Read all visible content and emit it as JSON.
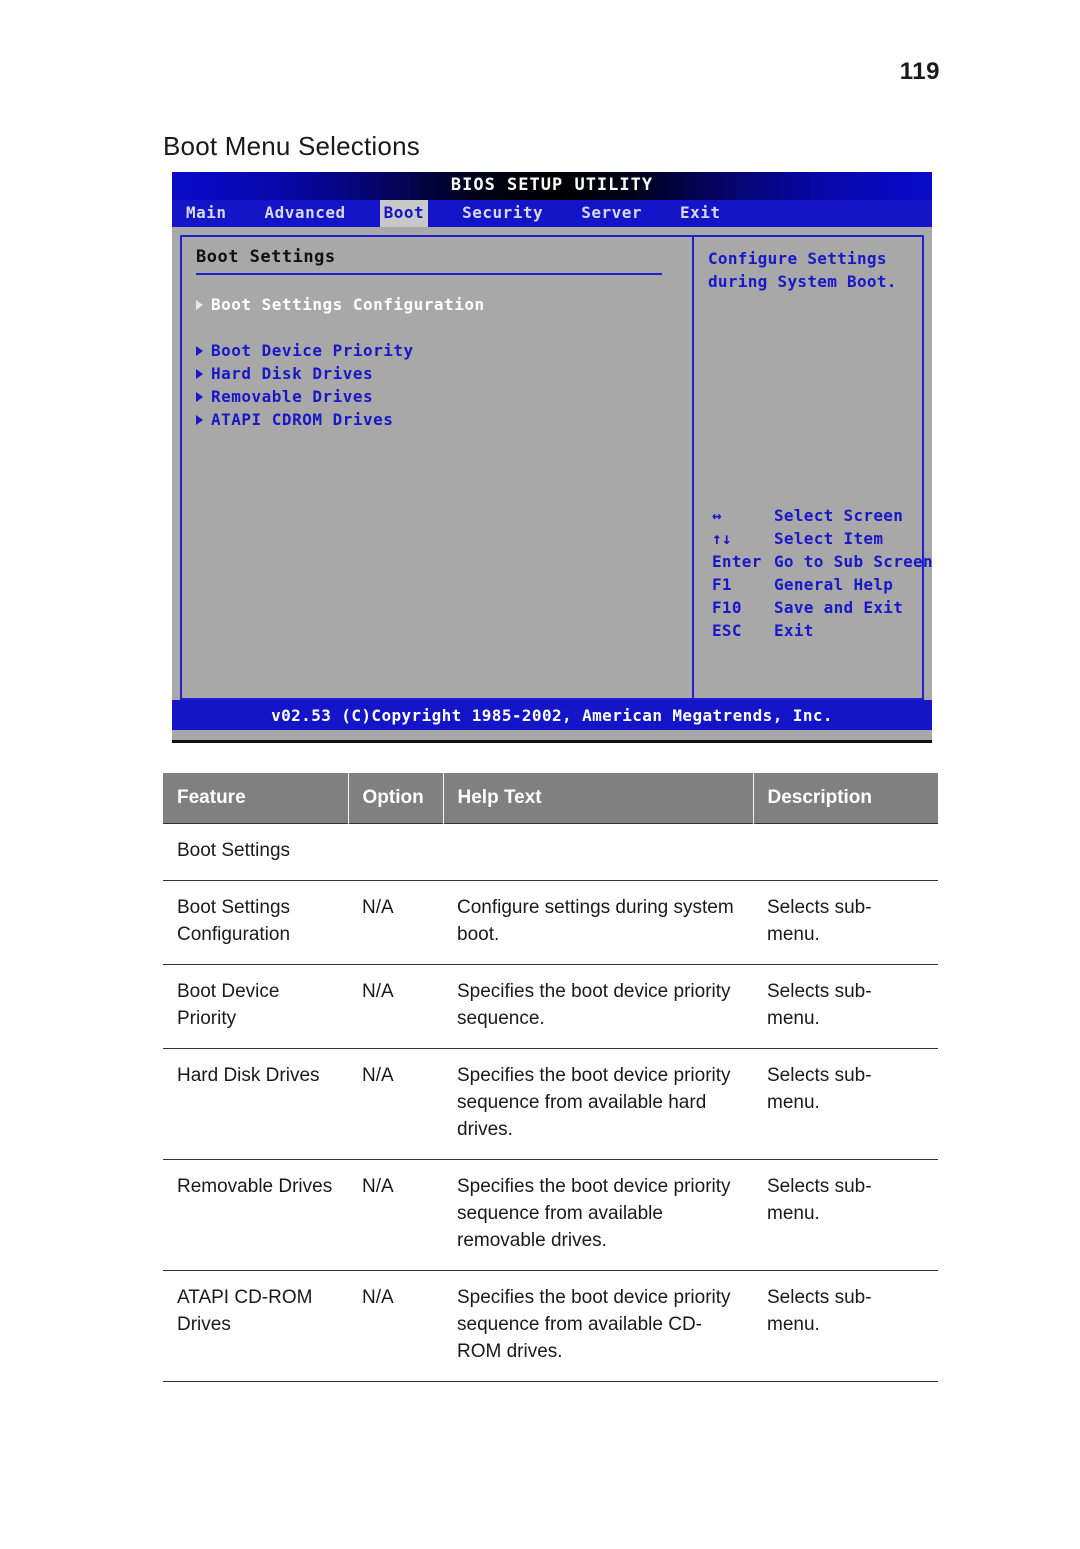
{
  "page": {
    "number": "119",
    "title": "Boot Menu Selections"
  },
  "bios": {
    "title": "BIOS SETUP UTILITY",
    "tabs": [
      {
        "label": "Main",
        "active": false
      },
      {
        "label": "Advanced",
        "active": false
      },
      {
        "label": "Boot",
        "active": true
      },
      {
        "label": "Security",
        "active": false
      },
      {
        "label": "Server",
        "active": false
      },
      {
        "label": "Exit",
        "active": false
      }
    ],
    "section_heading": "Boot Settings",
    "menu_items": [
      {
        "label": "Boot Settings Configuration",
        "selected": true
      },
      {
        "label": "Boot Device Priority",
        "selected": false
      },
      {
        "label": "Hard Disk Drives",
        "selected": false
      },
      {
        "label": "Removable Drives",
        "selected": false
      },
      {
        "label": "ATAPI CDROM Drives",
        "selected": false
      }
    ],
    "help_line1": "Configure Settings",
    "help_line2": "during System Boot.",
    "keys": [
      {
        "key": "↔",
        "desc": "Select Screen"
      },
      {
        "key": "↑↓",
        "desc": "Select Item"
      },
      {
        "key": "Enter",
        "desc": "Go to Sub Screen"
      },
      {
        "key": "F1",
        "desc": "General Help"
      },
      {
        "key": "F10",
        "desc": "Save and Exit"
      },
      {
        "key": "ESC",
        "desc": "Exit"
      }
    ],
    "footer": "v02.53 (C)Copyright 1985-2002, American Megatrends, Inc."
  },
  "table": {
    "headers": [
      "Feature",
      "Option",
      "Help Text",
      "Description"
    ],
    "rows": [
      {
        "feature": "Boot Settings",
        "option": "",
        "help": "",
        "description": ""
      },
      {
        "feature": "Boot Settings Configuration",
        "option": "N/A",
        "help": "Configure settings during system boot.",
        "description": "Selects sub-menu."
      },
      {
        "feature": "Boot Device Priority",
        "option": "N/A",
        "help": "Specifies the boot device priority sequence.",
        "description": "Selects sub-menu."
      },
      {
        "feature": "Hard Disk Drives",
        "option": "N/A",
        "help": "Specifies the boot device priority sequence from available hard drives.",
        "description": "Selects sub-menu."
      },
      {
        "feature": "Removable Drives",
        "option": "N/A",
        "help": "Specifies the boot device priority sequence from available removable drives.",
        "description": "Selects sub-menu."
      },
      {
        "feature": "ATAPI CD-ROM Drives",
        "option": "N/A",
        "help": "Specifies the boot device priority sequence from available CD-ROM drives.",
        "description": "Selects sub-menu."
      }
    ]
  },
  "colors": {
    "bios_blue": "#1414c8",
    "bios_gray": "#a8a8a8",
    "table_header_gray": "#808080"
  }
}
